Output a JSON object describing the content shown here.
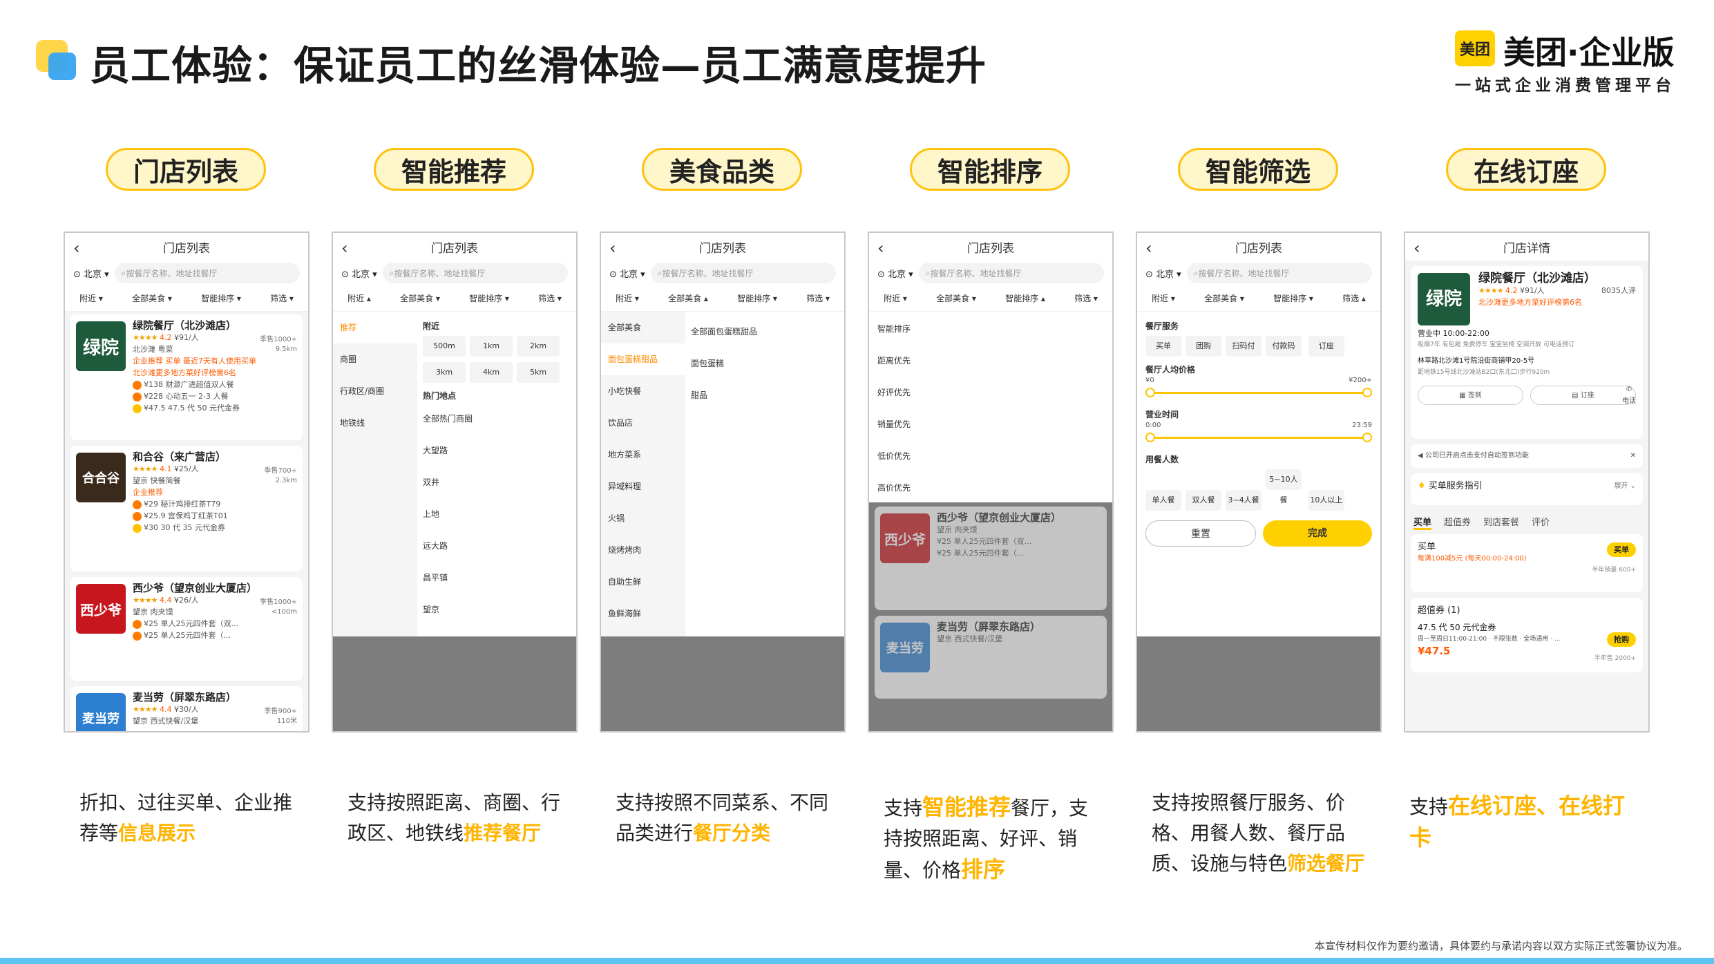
{
  "header": {
    "title": "员工体验：保证员工的丝滑体验—员工满意度提升",
    "brand_logo": "美团",
    "brand_name": "美团·企业版",
    "brand_slogan": "一站式企业消费管理平台"
  },
  "features": [
    {
      "pill": "门店列表"
    },
    {
      "pill": "智能推荐"
    },
    {
      "pill": "美食品类"
    },
    {
      "pill": "智能排序"
    },
    {
      "pill": "智能筛选"
    },
    {
      "pill": "在线订座"
    }
  ],
  "descriptions": [
    {
      "pre": "折扣、过往买单、企业推荐等",
      "hl": "信息展示",
      "post": ""
    },
    {
      "pre": "支持按照距离、商圈、行政区、地铁线",
      "hl": "推荐餐厅",
      "post": ""
    },
    {
      "pre": "支持按照不同菜系、不同品类进行",
      "hl": "餐厅分类",
      "post": ""
    },
    {
      "pre": "支持",
      "hl": "智能推荐",
      "post": "餐厅，支持按照距离、好评、销量、价格",
      "hl2": "排序"
    },
    {
      "pre": "支持按照餐厅服务、价格、用餐人数、餐厅品质、设施与特色",
      "hl": "筛选餐厅",
      "post": ""
    },
    {
      "pre": "支持",
      "hl": "在线订座",
      "post": "、",
      "hl2": "在线打卡"
    }
  ],
  "phone": {
    "list_title": "门店列表",
    "detail_title": "门店详情",
    "city": "北京",
    "search_placeholder": "按餐厅名称、地址找餐厅",
    "filters": [
      "附近",
      "全部美食",
      "智能排序",
      "筛选"
    ]
  },
  "restaurants": [
    {
      "logo": "绿院",
      "name": "绿院餐厅（北沙滩店）",
      "rating": "4.2",
      "price": "¥91/人",
      "area": "北沙滩 粤菜",
      "sales": "季售1000+",
      "dist": "9.5km",
      "tag": "企业推荐 买单 最近7天有人使用买单",
      "rank": "北沙滩更多地方菜好评榜第6名",
      "deals": [
        "¥138 财源广进超值双人餐",
        "¥228 心动五一 2-3 人餐",
        "¥47.5 47.5 代 50 元代金券"
      ]
    },
    {
      "logo": "合合谷",
      "name": "和合谷（来广营店）",
      "rating": "4.1",
      "price": "¥25/人",
      "area": "望京 快餐简餐",
      "sales": "季售700+",
      "dist": "2.3km",
      "tag": "企业推荐",
      "rank": "",
      "deals": [
        "¥29 秘汁鸡排红茶T79",
        "¥25.9 宫保鸡丁红茶T01",
        "¥30 30 代 35 元代金券"
      ]
    },
    {
      "logo": "西少爷",
      "name": "西少爷（望京创业大厦店）",
      "rating": "4.4",
      "price": "¥26/人",
      "area": "望京 肉夹馍",
      "sales": "季售1000+",
      "dist": "<100m",
      "tag": "",
      "rank": "",
      "deals": [
        "¥25 单人25元四件套（双...",
        "¥25 单人25元四件套（..."
      ]
    },
    {
      "logo": "麦当劳",
      "name": "麦当劳（屏翠东路店）",
      "rating": "4.4",
      "price": "¥30/人",
      "area": "望京 西式快餐/汉堡",
      "sales": "季售900+",
      "dist": "110米",
      "tag": "",
      "rank": "",
      "deals": []
    }
  ],
  "location_panel": {
    "left": [
      "推荐",
      "商圈",
      "行政区/商圈",
      "地铁线"
    ],
    "nearby_title": "附近",
    "distances": [
      "500m",
      "1km",
      "2km",
      "3km",
      "4km",
      "5km"
    ],
    "hot_title": "热门地点",
    "hot": [
      "全部热门商圈",
      "大望路",
      "双井",
      "上地",
      "远大路",
      "昌平镇",
      "望京"
    ]
  },
  "category_panel": {
    "left": [
      "全部美食",
      "面包蛋糕甜品",
      "小吃快餐",
      "饮品店",
      "地方菜系",
      "异域料理",
      "火锅",
      "烧烤烤肉",
      "自助生鲜",
      "鱼鲜海鲜"
    ],
    "right": [
      "全部面包蛋糕甜品",
      "面包蛋糕",
      "甜品"
    ]
  },
  "sort_panel": {
    "items": [
      "智能排序",
      "距离优先",
      "好评优先",
      "销量优先",
      "低价优先",
      "高价优先"
    ]
  },
  "filter_panel": {
    "service_title": "餐厅服务",
    "services": [
      "买单",
      "团购",
      "扫码付",
      "付款码",
      "订座"
    ],
    "price_title": "餐厅人均价格",
    "price_min": "¥0",
    "price_max": "¥200+",
    "time_title": "营业时间",
    "time_min": "0:00",
    "time_max": "23:59",
    "people_title": "用餐人数",
    "people": [
      "单人餐",
      "双人餐",
      "3~4人餐",
      "5~10人餐",
      "10人以上"
    ],
    "reset": "重置",
    "done": "完成"
  },
  "detail": {
    "name": "绿院餐厅（北沙滩店）",
    "rating": "4.2",
    "price": "¥91/人",
    "reviews": "8035人评",
    "rank": "北沙滩更多地方菜好评榜第6名",
    "hours": "营业中 10:00-22:00",
    "facilities": "吸烟7年 有包厢 免费停车 宝宝坐椅 空调开放 可电话预订",
    "address": "林萃路北沙滩1号院沿街商铺甲20-5号",
    "subway": "距地铁15号线北沙滩站B2口(东北口)步行920m",
    "call": "电话",
    "btn_book": "签到",
    "btn_checkin": "订座",
    "notice": "公司已开启点击支付自动签到功能",
    "guide": "买单服务指引",
    "guide_more": "展开",
    "tabs": [
      "买单",
      "超值券",
      "到店套餐",
      "评价"
    ],
    "buy_title": "买单",
    "buy_desc": "每满100减5元 (每天00:00-24:00)",
    "buy_btn": "买单",
    "buy_sales": "半年销量 600+",
    "coupon_title": "超值券 (1)",
    "coupon_name": "47.5 代 50 元代金券",
    "coupon_desc": "周一至周日11:00-21:00 · 不限张数 · 全场通用 · ...",
    "coupon_price": "¥47.5",
    "coupon_btn": "抢购",
    "coupon_sales": "半年售 2000+"
  },
  "footnote": "本宣传材料仅作为要约邀请，具体要约与承诺内容以双方实际正式签署协议为准。",
  "colors": {
    "accent_yellow": "#ffc20e",
    "highlight": "#ffb400",
    "brand": "#ffd100",
    "bar": "#5fc3f2"
  }
}
